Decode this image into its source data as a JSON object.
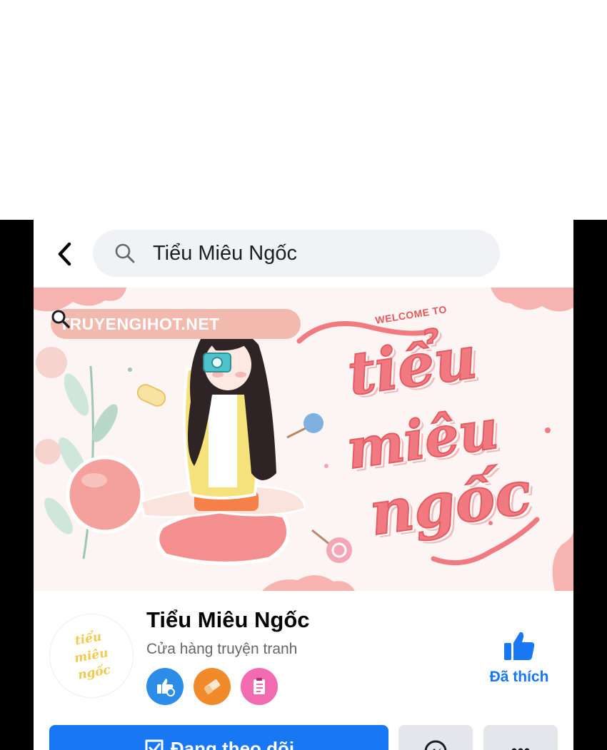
{
  "search": {
    "query": "Tiểu Miêu Ngốc"
  },
  "cover": {
    "watermark": "TRUYENGIHOT.NET",
    "welcome": "WELCOME TO",
    "title_line1": "tiểu",
    "title_line2": "miêu",
    "title_line3": "ngốc"
  },
  "profile": {
    "avatar_line1": "tiểu",
    "avatar_line2": "miêu",
    "avatar_line3": "ngốc",
    "name": "Tiểu Miêu Ngốc",
    "category": "Cửa hàng truyện tranh",
    "badges": [
      "like-recommend-icon",
      "eraser-icon",
      "clipboard-icon"
    ],
    "like_label": "Đã thích"
  },
  "actions": {
    "follow_label": "Đang theo dõi",
    "message_icon": "messenger-icon",
    "more_icon": "more-dots-icon"
  },
  "colors": {
    "brand_blue": "#1877f2",
    "search_bg": "#f0f2f5",
    "cover_pink": "#f07a80"
  }
}
